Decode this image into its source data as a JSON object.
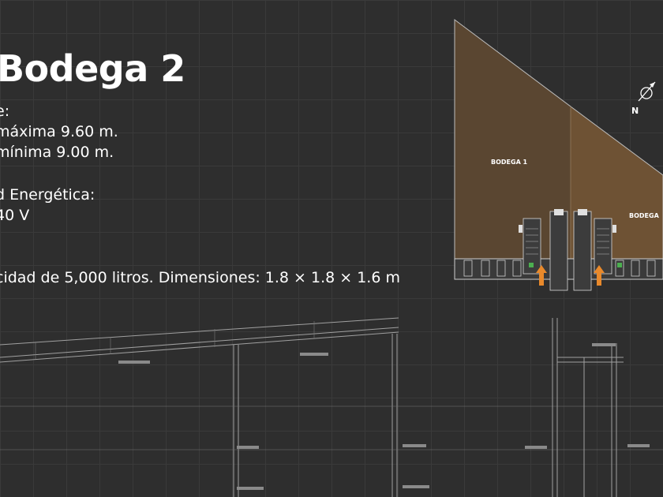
{
  "slide": {
    "title": "Bodega 2",
    "lines": [
      "e:",
      "máxima 9.60 m.",
      "mínima 9.00 m.",
      "d Energética:",
      "40 V",
      "cidad de 5,000 litros. Dimensiones: 1.8 × 1.8 × 1.6 m"
    ]
  },
  "floor_plan": {
    "label_bodega_1": "BODEGA 1",
    "label_bodega_2": "BODEGA",
    "north_label": "N"
  },
  "colors": {
    "background": "#2e2e2e",
    "bodega_1_fill": "#5a4631",
    "bodega_2_fill": "#6e5234",
    "arrow": "#e8892b",
    "drawing_lines": "#9a9a9a"
  }
}
